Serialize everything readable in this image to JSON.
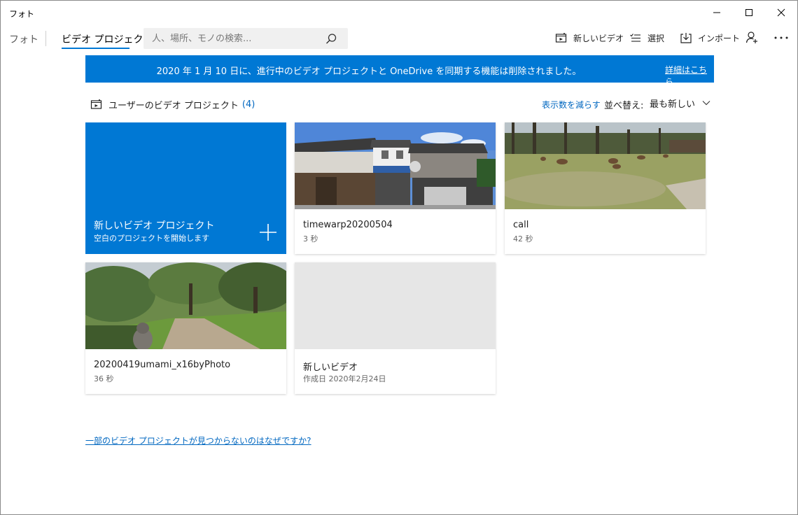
{
  "window": {
    "title": "フォト",
    "controls": {
      "minimize_icon": "minimize-icon",
      "maximize_icon": "maximize-icon",
      "close_icon": "close-icon"
    }
  },
  "nav": {
    "photos_label": "フォト",
    "video_projects_label": "ビデオ プロジェクト",
    "search_placeholder": "人、場所、モノの検索...",
    "commands": {
      "new_video": "新しいビデオ",
      "select": "選択",
      "import": "インポート"
    }
  },
  "banner": {
    "message": "2020 年 1 月 10 日に、進行中のビデオ プロジェクトと OneDrive を同期する機能は削除されました。",
    "link": "詳細はこちら"
  },
  "section": {
    "title": "ユーザーのビデオ プロジェクト",
    "count": "(4)",
    "show_fewer": "表示数を減らす",
    "sort_label": "並べ替え:",
    "sort_value": "最も新しい"
  },
  "new_project_tile": {
    "title": "新しいビデオ プロジェクト",
    "subtitle": "空白のプロジェクトを開始します"
  },
  "projects": [
    {
      "title": "timewarp20200504",
      "duration": "3 秒"
    },
    {
      "title": "call",
      "duration": "42 秒"
    },
    {
      "title": "20200419umami_x16byPhoto",
      "duration": "36 秒"
    },
    {
      "title": "新しいビデオ",
      "duration": "作成日 2020年2月24日"
    }
  ],
  "help_link": "一部のビデオ プロジェクトが見つからないのはなぜですか?",
  "colors": {
    "accent": "#0078d4",
    "link": "#0067c0"
  }
}
